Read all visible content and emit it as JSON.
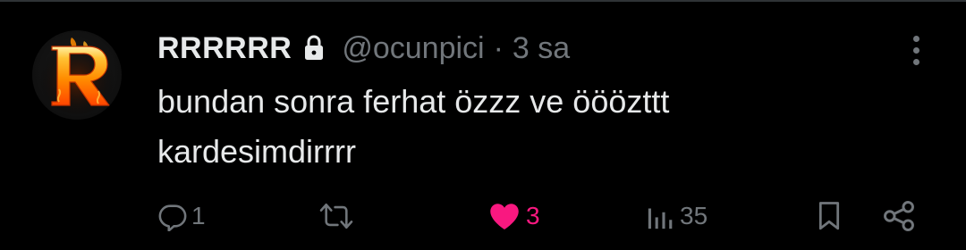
{
  "colors": {
    "background": "#000000",
    "text_primary": "#e7e9ea",
    "text_secondary": "#71767b",
    "like_active": "#f91880",
    "divider": "#2f3336"
  },
  "tweet": {
    "avatar": {
      "letter": "R",
      "icon": "flaming-letter-r"
    },
    "display_name": "RRRRRR",
    "protected_icon": "lock-icon",
    "handle": "@ocunpici",
    "separator": "·",
    "time": "3 sa",
    "text_lines": [
      "bundan sonra ferhat özzz ve ööözttt",
      "kardesimdirrrr"
    ],
    "actions": {
      "reply_count": "1",
      "retweet_count": "",
      "like_count": "3",
      "liked": true,
      "views_count": "35"
    }
  }
}
